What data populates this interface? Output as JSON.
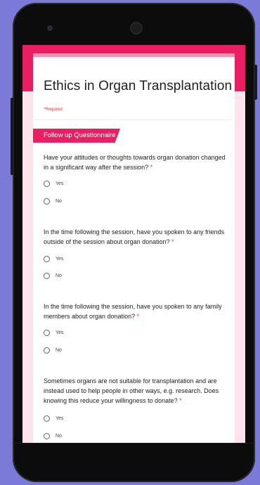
{
  "form": {
    "title": "Ethics in Organ Transplantation",
    "required_note": "*Required",
    "section_title": "Follow up Questionnaire",
    "required_mark": "*",
    "questions": [
      {
        "text": "Have your attitudes or thoughts towards organ donation changed in a significant way after the session?",
        "options": [
          "Yes",
          "No"
        ]
      },
      {
        "text": "In the time following the session, have you spoken to any friends outside of the session about organ donation?",
        "options": [
          "Yes",
          "No"
        ]
      },
      {
        "text": "In the time following the session, have you spoken to any family members about organ donation?",
        "options": [
          "Yes",
          "No"
        ]
      },
      {
        "text": "Sometimes organs are not suitable for transplantation and are instead used to help people in other ways, e.g. research. Does knowing this reduce your willingness to donate?",
        "options": [
          "Yes",
          "No"
        ]
      }
    ]
  },
  "colors": {
    "accent": "#e91e63",
    "background": "#7b7ad8",
    "screen_bg": "#fde4ec",
    "required": "#e53935"
  }
}
